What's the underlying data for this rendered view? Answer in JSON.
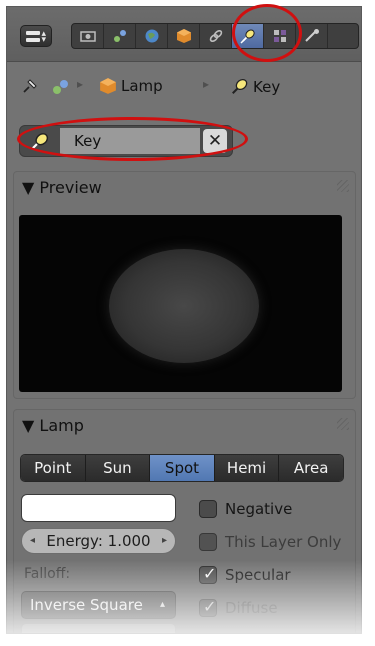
{
  "toolbar": {
    "tabs": [
      {
        "name": "render",
        "icon": "camera-icon",
        "active": false
      },
      {
        "name": "scene",
        "icon": "scene-icon",
        "active": false
      },
      {
        "name": "world",
        "icon": "world-icon",
        "active": false
      },
      {
        "name": "object",
        "icon": "cube-icon",
        "active": false
      },
      {
        "name": "constraints",
        "icon": "chain-icon",
        "active": false
      },
      {
        "name": "data",
        "icon": "lamp-data-icon",
        "active": true
      },
      {
        "name": "texture",
        "icon": "texture-icon",
        "active": false
      },
      {
        "name": "physics",
        "icon": "physics-icon",
        "active": false
      }
    ],
    "highlight_color": "#d01010"
  },
  "breadcrumb": {
    "object_label": "Lamp",
    "data_label": "Key"
  },
  "datablock": {
    "name": "Key",
    "clear_symbol": "✕"
  },
  "preview": {
    "title": "Preview"
  },
  "lamp": {
    "title": "Lamp",
    "types": [
      "Point",
      "Sun",
      "Spot",
      "Hemi",
      "Area"
    ],
    "active_type": "Spot",
    "color": "#ffffff",
    "energy_label": "Energy: 1.000",
    "falloff_label": "Falloff:",
    "falloff_value": "Inverse Square",
    "checkboxes": [
      {
        "label": "Negative",
        "checked": false
      },
      {
        "label": "This Layer Only",
        "checked": false
      },
      {
        "label": "Specular",
        "checked": true
      },
      {
        "label": "Diffuse",
        "checked": true
      }
    ]
  },
  "colors": {
    "accent": "#5178b2",
    "panel": "#737373"
  }
}
